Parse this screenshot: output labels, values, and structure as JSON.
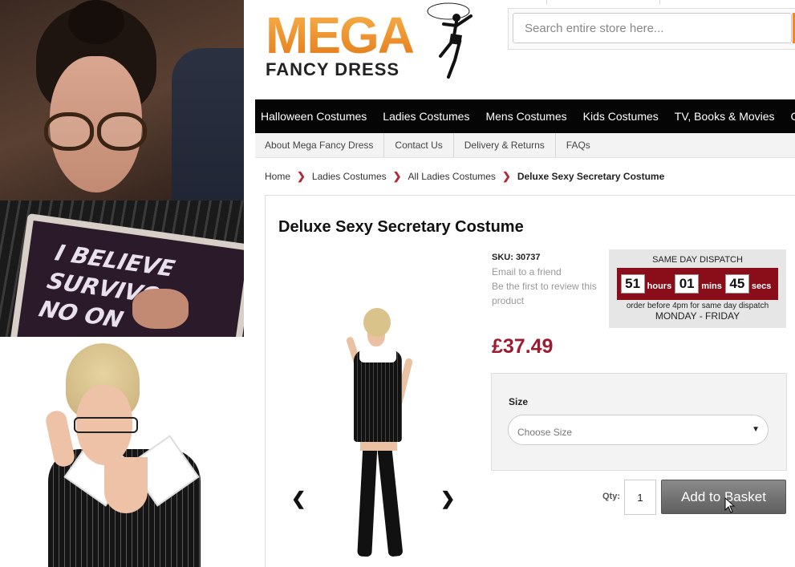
{
  "logo": {
    "mega": "MEGA",
    "fancy": "FANCY DRESS"
  },
  "search": {
    "placeholder": "Search entire store here..."
  },
  "mainnav": [
    "Halloween Costumes",
    "Ladies Costumes",
    "Mens Costumes",
    "Kids Costumes",
    "TV, Books & Movies",
    "C"
  ],
  "subnav": [
    "About Mega Fancy Dress",
    "Contact Us",
    "Delivery & Returns",
    "FAQs"
  ],
  "breadcrumb": {
    "home": "Home",
    "level1": "Ladies Costumes",
    "level2": "All Ladies Costumes",
    "current": "Deluxe Sexy Secretary Costume"
  },
  "product": {
    "title": "Deluxe Sexy Secretary Costume",
    "sku": "SKU: 30737",
    "email": "Email to a friend",
    "review": "Be the first to review this product",
    "price": "£37.49"
  },
  "dispatch": {
    "title": "SAME DAY DISPATCH",
    "hours": "51",
    "hours_label": "hours",
    "mins": "01",
    "mins_label": "mins",
    "secs": "45",
    "secs_label": "secs",
    "note": "order before 4pm for same day dispatch",
    "days": "MONDAY - FRIDAY"
  },
  "options": {
    "size_label": "Size",
    "size_placeholder": "Choose Size"
  },
  "cart": {
    "qty_label": "Qty:",
    "qty_value": "1",
    "add_label": "Add to Basket"
  },
  "photo_sign": {
    "line1": "I BELIEVE",
    "line2": "SURVIVO",
    "line3": "NO ON"
  },
  "colors": {
    "brand_orange": "#f39a2a",
    "price_red": "#9b1b30",
    "timer_bg": "#8a0d1a",
    "nav_bg": "#050505"
  },
  "icons": {
    "prev": "chevron-left-icon",
    "next": "chevron-right-icon",
    "caret": "caret-down-icon",
    "cursor": "mouse-pointer-icon"
  }
}
